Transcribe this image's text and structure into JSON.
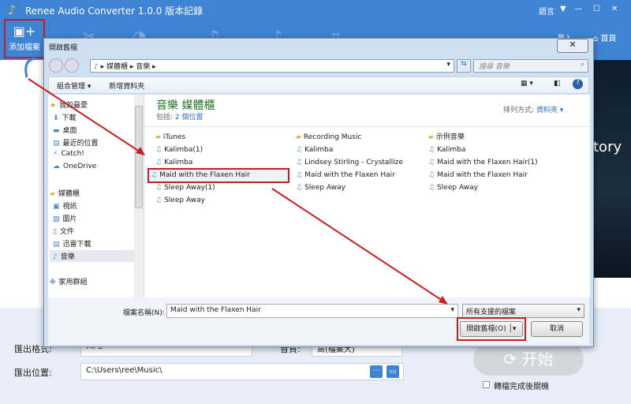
{
  "app": {
    "title": "Renee Audio Converter 1.0.0 版本記錄",
    "language": "語言",
    "login": "登入",
    "home": "首頁",
    "add_file": "添加檔案",
    "banner_text": "tory"
  },
  "dialog": {
    "title": "開啟舊檔",
    "breadcrumb": [
      "媒體櫃",
      "音樂"
    ],
    "search_placeholder": "搜尋 音樂",
    "toolbar": {
      "organize": "組合管理 ▾",
      "new_folder": "新增資料夾"
    },
    "nav": {
      "favorites": "我的最愛",
      "fav_items": [
        "下載",
        "桌面",
        "最近的位置",
        "Catch!",
        "OneDrive"
      ],
      "libraries": "媒體櫃",
      "lib_items": [
        "視訊",
        "圖片",
        "文件",
        "迅雷下載",
        "音樂"
      ],
      "homegroup": "家用群組"
    },
    "library_title": "音樂 媒體櫃",
    "includes_label": "包括:",
    "includes_link": "2 個位置",
    "sort_label": "排列方式:",
    "sort_value": "資料夾 ▾",
    "columns": [
      [
        "iTunes",
        "Kalimba(1)",
        "Kalimba",
        "Maid with the Flaxen Hair",
        "Sleep Away(1)",
        "Sleep Away"
      ],
      [
        "Recording Music",
        "Kalimba",
        "Lindsey Stirling - Crystallize",
        "Maid with the Flaxen Hair",
        "Sleep Away"
      ],
      [
        "示例音樂",
        "Kalimba",
        "Maid with the Flaxen Hair(1)",
        "Maid with the Flaxen Hair",
        "Sleep Away"
      ]
    ],
    "filename_label": "檔案名稱(N):",
    "filename_value": "Maid with the Flaxen Hair",
    "filetype": "所有支援的檔案",
    "open": "開啟舊檔(O)",
    "cancel": "取消"
  },
  "bottom": {
    "format_label": "匯出格式:",
    "format_value": "MP3",
    "quality_label": "音質:",
    "quality_value": "高(檔案大)",
    "output_label": "匯出位置:",
    "output_value": "C:\\Users\\ree\\Music\\",
    "start": "开始",
    "shutdown": "轉檔完成後關機"
  },
  "colors": {
    "accent": "#3f84d4",
    "highlight": "#c81e1e"
  }
}
